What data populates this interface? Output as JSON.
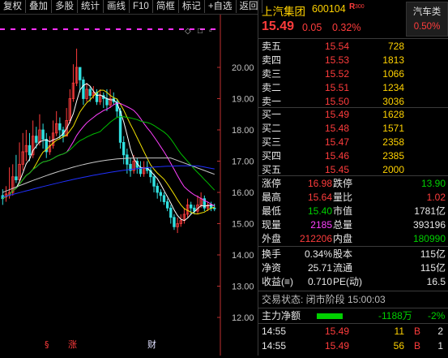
{
  "toolbar": [
    "复权",
    "叠加",
    "多股",
    "统计",
    "画线",
    "F10",
    "简框",
    "标记",
    "+自选",
    "返回"
  ],
  "chart": {
    "y_ticks": [
      "20.00",
      "19.00",
      "18.00",
      "17.00",
      "16.00",
      "15.00",
      "14.00",
      "13.00",
      "12.00"
    ],
    "markers": [
      "§",
      "涨",
      "财"
    ]
  },
  "header": {
    "name": "上汽集团",
    "code": "600104",
    "flag": "R",
    "flag_num": "300",
    "sector": "汽车类",
    "sector_pct": "0.50%",
    "price": "15.49",
    "change": "0.05",
    "pct": "0.32%"
  },
  "asks": [
    {
      "label": "卖五",
      "price": "15.54",
      "vol": "728"
    },
    {
      "label": "卖四",
      "price": "15.53",
      "vol": "1813"
    },
    {
      "label": "卖三",
      "price": "15.52",
      "vol": "1066"
    },
    {
      "label": "卖二",
      "price": "15.51",
      "vol": "1234"
    },
    {
      "label": "卖一",
      "price": "15.50",
      "vol": "3036"
    }
  ],
  "bids": [
    {
      "label": "买一",
      "price": "15.49",
      "vol": "1628"
    },
    {
      "label": "买二",
      "price": "15.48",
      "vol": "1571"
    },
    {
      "label": "买三",
      "price": "15.47",
      "vol": "2358"
    },
    {
      "label": "买四",
      "price": "15.46",
      "vol": "2385"
    },
    {
      "label": "买五",
      "price": "15.45",
      "vol": "2000"
    }
  ],
  "stats": [
    [
      {
        "l": "涨停",
        "v": "16.98",
        "c": "red"
      },
      {
        "l": "跌停",
        "v": "13.90",
        "c": "green"
      }
    ],
    [
      {
        "l": "最高",
        "v": "15.64",
        "c": "red"
      },
      {
        "l": "量比",
        "v": "1.02",
        "c": "red"
      }
    ],
    [
      {
        "l": "最低",
        "v": "15.40",
        "c": "green"
      },
      {
        "l": "市值",
        "v": "1781亿",
        "c": "white"
      }
    ],
    [
      {
        "l": "现量",
        "v": "2185",
        "c": "magenta"
      },
      {
        "l": "总量",
        "v": "393196",
        "c": "white"
      }
    ],
    [
      {
        "l": "外盘",
        "v": "212206",
        "c": "red"
      },
      {
        "l": "内盘",
        "v": "180990",
        "c": "green"
      }
    ]
  ],
  "fundamentals": [
    [
      {
        "l": "换手",
        "v": "0.34%"
      },
      {
        "l": "股本",
        "v": "115亿"
      }
    ],
    [
      {
        "l": "净资",
        "v": "25.71"
      },
      {
        "l": "流通",
        "v": "115亿"
      }
    ],
    [
      {
        "l": "收益(≡)",
        "v": "0.710"
      },
      {
        "l": "PE(动)",
        "v": "16.5"
      }
    ]
  ],
  "status": "交易状态: 闭市阶段 15:00:03",
  "main_flow": {
    "label": "主力净额",
    "value": "-1188万",
    "pct": "-2%",
    "bar_fraction": 0.4
  },
  "ticks": [
    {
      "time": "14:55",
      "price": "15.49",
      "vol": "11",
      "side": "B",
      "trades": "2"
    },
    {
      "time": "14:55",
      "price": "15.49",
      "vol": "56",
      "side": "B",
      "trades": "1"
    }
  ],
  "colors": {
    "up": "#ff3c3c",
    "down": "#00d000",
    "ma5": "#ffffff",
    "ma10": "#f0e000",
    "ma20": "#ff40ff",
    "ma30": "#00c000",
    "ma60": "#c8c8c8",
    "ma120": "#2030ff"
  }
}
